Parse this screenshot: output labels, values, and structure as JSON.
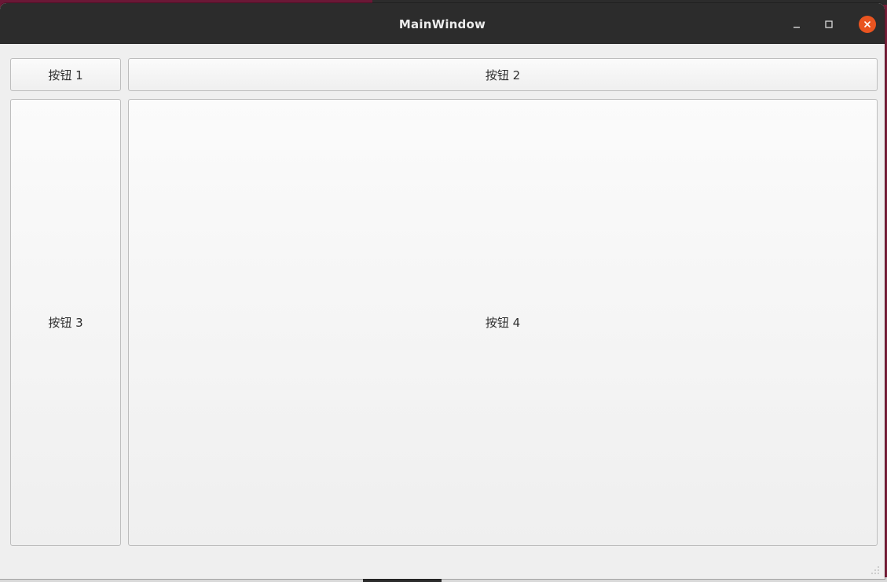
{
  "window": {
    "title": "MainWindow",
    "controls": {
      "minimize_icon": "minimize-icon",
      "maximize_icon": "maximize-icon",
      "close_icon": "close-icon",
      "close_color": "#e95420"
    }
  },
  "buttons": {
    "b1": "按钮 1",
    "b2": "按钮 2",
    "b3": "按钮 3",
    "b4": "按钮 4"
  },
  "colors": {
    "titlebar": "#2c2c2c",
    "window_bg": "#efefef",
    "accent": "#e95420"
  }
}
